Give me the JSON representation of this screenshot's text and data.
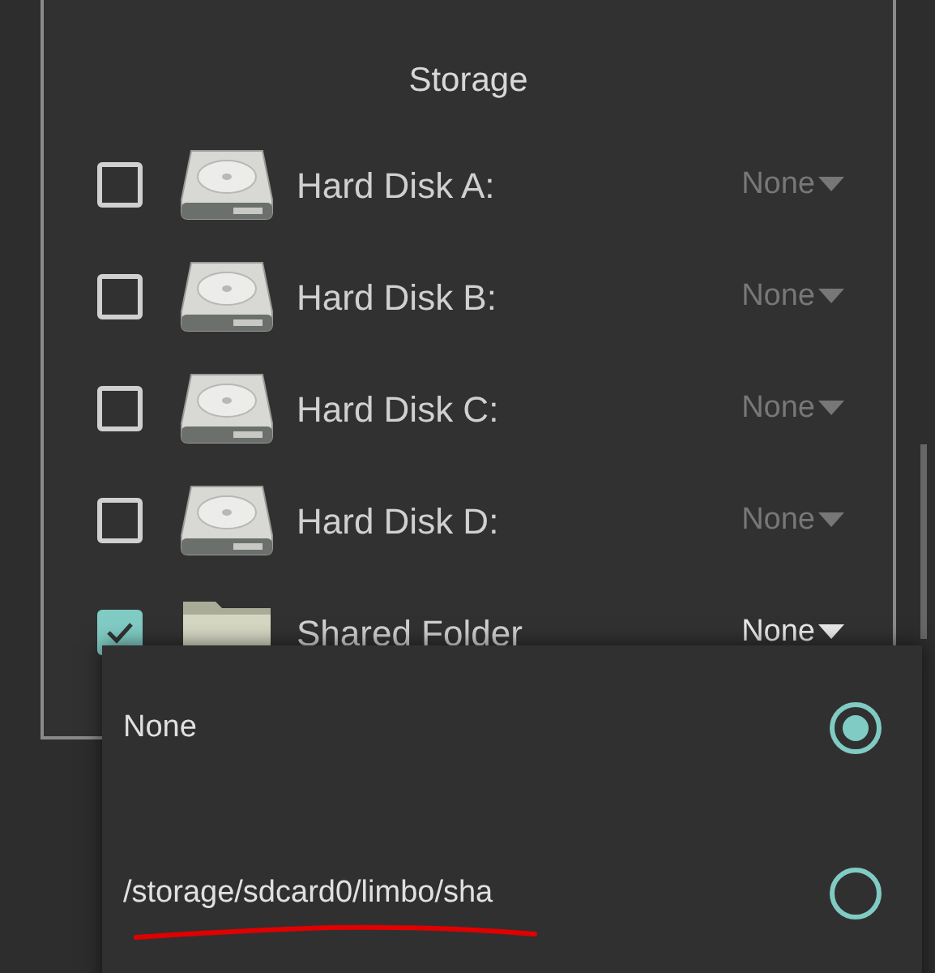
{
  "panel": {
    "title": "Storage"
  },
  "drives": [
    {
      "kind": "disk",
      "label": "Hard Disk A:",
      "checked": false,
      "value": "None"
    },
    {
      "kind": "disk",
      "label": "Hard Disk B:",
      "checked": false,
      "value": "None"
    },
    {
      "kind": "disk",
      "label": "Hard Disk C:",
      "checked": false,
      "value": "None"
    },
    {
      "kind": "disk",
      "label": "Hard Disk D:",
      "checked": false,
      "value": "None"
    },
    {
      "kind": "folder",
      "label": "Shared Folder",
      "checked": true,
      "value": "None"
    }
  ],
  "popup": {
    "options": [
      {
        "label": "None",
        "selected": true
      },
      {
        "label": "/storage/sdcard0/limbo/sha",
        "selected": false
      }
    ]
  }
}
